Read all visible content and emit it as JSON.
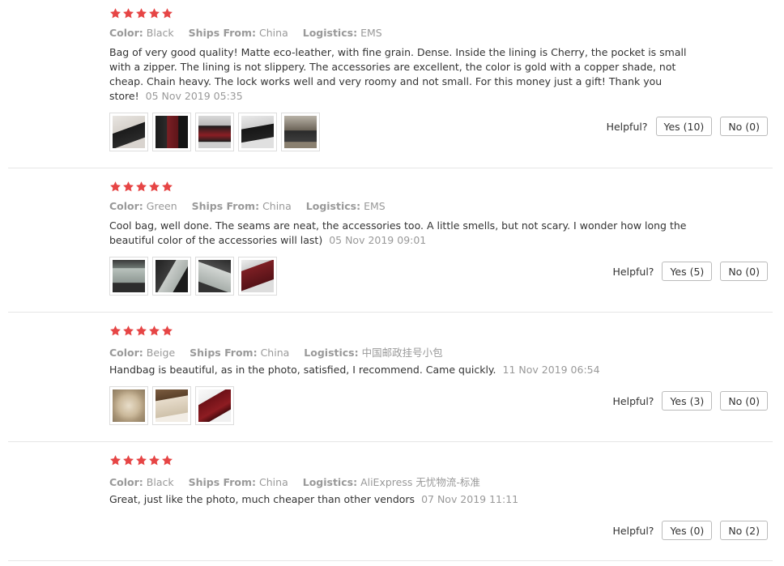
{
  "labels": {
    "color": "Color:",
    "ships_from": "Ships From:",
    "logistics": "Logistics:",
    "helpful": "Helpful?"
  },
  "colors": {
    "star": "#e64545",
    "meta": "#999999"
  },
  "reviews": [
    {
      "rating": 5,
      "color": "Black",
      "ships_from": "China",
      "logistics": "EMS",
      "text": "Bag of very good quality! Matte eco-leather, with fine grain. Dense. Inside the lining is Cherry, the pocket is small with a zipper. The lining is not slippery. The accessories are excellent, the color is gold with a copper shade, not cheap. Chain heavy. The lock works well and very roomy and not small. For this money just a gift! Thank you store!",
      "date": "05 Nov 2019 05:35",
      "photos": [
        "black bag on white",
        "bag with red lining",
        "bag interior red",
        "black bag chain",
        "person wearing bag"
      ],
      "yes": "Yes (10)",
      "no": "No (0)"
    },
    {
      "rating": 5,
      "color": "Green",
      "ships_from": "China",
      "logistics": "EMS",
      "text": "Cool bag, well done. The seams are neat, the accessories too. A little smells, but not scary. I wonder how long the beautiful color of the accessories will last)",
      "date": "05 Nov 2019 09:01",
      "photos": [
        "green bag front",
        "green bag strap",
        "green bag side",
        "bag red lining"
      ],
      "yes": "Yes (5)",
      "no": "No (0)"
    },
    {
      "rating": 5,
      "color": "Beige",
      "ships_from": "China",
      "logistics": "中国邮政挂号小包",
      "text": "Handbag is beautiful, as in the photo, satisfied, I recommend. Came quickly.",
      "date": "11 Nov 2019 06:54",
      "photos": [
        "beige bag packaging",
        "beige bag front",
        "bag burgundy lining"
      ],
      "yes": "Yes (3)",
      "no": "No (0)"
    },
    {
      "rating": 5,
      "color": "Black",
      "ships_from": "China",
      "logistics": "AliExpress 无忧物流-标准",
      "text": "Great, just like the photo, much cheaper than other vendors",
      "date": "07 Nov 2019 11:11",
      "photos": [],
      "yes": "Yes (0)",
      "no": "No (2)"
    }
  ]
}
